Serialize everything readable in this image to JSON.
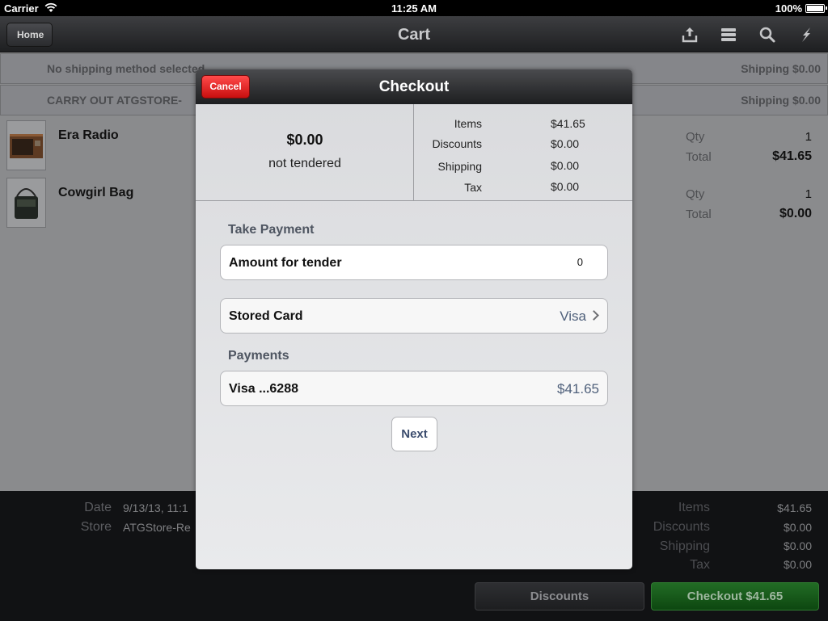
{
  "status_bar": {
    "carrier": "Carrier",
    "time": "11:25 AM",
    "battery": "100%"
  },
  "navbar": {
    "back_label": "Home",
    "title": "Cart",
    "icons": [
      "share-icon",
      "list-icon",
      "search-icon",
      "lightning-icon"
    ]
  },
  "cart": {
    "shipping_rows": [
      {
        "label": "No shipping method selected",
        "value": "Shipping $0.00"
      },
      {
        "label": "CARRY OUT ATGSTORE-",
        "value": "Shipping $0.00"
      }
    ],
    "items": [
      {
        "name": "Era Radio",
        "qty_label": "Qty",
        "qty": "1",
        "total_label": "Total",
        "total": "$41.65"
      },
      {
        "name": "Cowgirl Bag",
        "qty_label": "Qty",
        "qty": "1",
        "total_label": "Total",
        "total": "$0.00"
      }
    ]
  },
  "footer": {
    "date_label": "Date",
    "date_value": "9/13/13, 11:1",
    "store_label": "Store",
    "store_value": "ATGStore-Re",
    "summary": [
      {
        "label": "Items",
        "value": "$41.65"
      },
      {
        "label": "Discounts",
        "value": "$0.00"
      },
      {
        "label": "Shipping",
        "value": "$0.00"
      },
      {
        "label": "Tax",
        "value": "$0.00"
      }
    ],
    "discounts_button": "Discounts",
    "checkout_button": "Checkout $41.65"
  },
  "modal": {
    "title": "Checkout",
    "cancel_label": "Cancel",
    "tendered_amount": "$0.00",
    "tendered_status": "not tendered",
    "summary": [
      {
        "label": "Items",
        "value": "$41.65"
      },
      {
        "label": "Discounts",
        "value": "$0.00"
      },
      {
        "label": "Shipping",
        "value": "$0.00"
      },
      {
        "label": "Tax",
        "value": "$0.00"
      }
    ],
    "take_payment_label": "Take Payment",
    "amount_label": "Amount for tender",
    "amount_value": "0",
    "stored_card_label": "Stored Card",
    "stored_card_value": "Visa",
    "payments_label": "Payments",
    "payment_label": "Visa ...6288",
    "payment_value": "$41.65",
    "next_label": "Next"
  },
  "colors": {
    "checkout_green": "#1a5e1d",
    "cancel_red": "#e51c1c",
    "detail_blue": "#4f607b"
  }
}
